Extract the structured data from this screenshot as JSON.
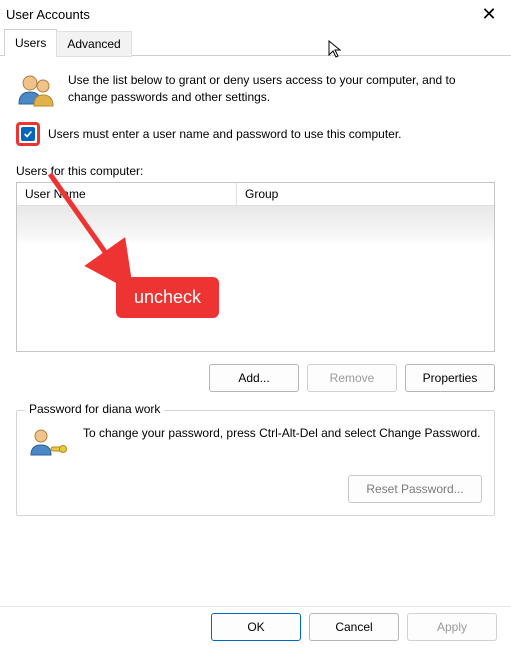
{
  "window": {
    "title": "User Accounts"
  },
  "tabs": {
    "users": "Users",
    "advanced": "Advanced"
  },
  "intro": "Use the list below to grant or deny users access to your computer, and to change passwords and other settings.",
  "checkbox_label": "Users must enter a user name and password to use this computer.",
  "list_label": "Users for this computer:",
  "columns": {
    "username": "User Name",
    "group": "Group"
  },
  "buttons": {
    "add": "Add...",
    "remove": "Remove",
    "properties": "Properties",
    "reset_password": "Reset Password...",
    "ok": "OK",
    "cancel": "Cancel",
    "apply": "Apply"
  },
  "password_group": {
    "title": "Password for diana work",
    "text": "To change your password, press Ctrl-Alt-Del and select Change Password."
  },
  "annotation": {
    "label": "uncheck"
  }
}
